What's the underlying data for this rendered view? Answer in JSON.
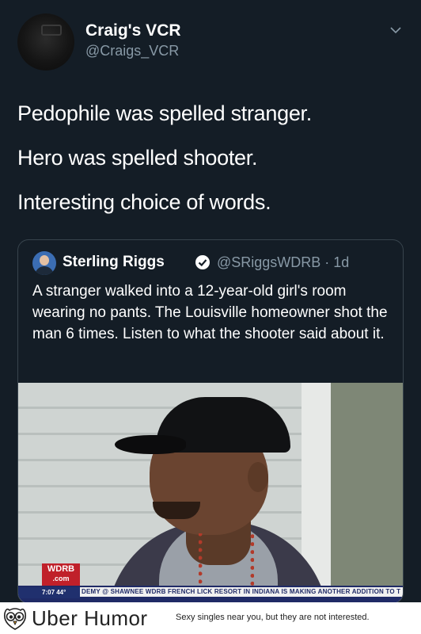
{
  "tweet": {
    "name": "Craig's VCR",
    "handle": "@Craigs_VCR",
    "lines": [
      "Pedophile was spelled stranger.",
      "Hero was spelled shooter.",
      "Interesting choice of words."
    ]
  },
  "quoted": {
    "name": "Sterling Riggs",
    "handle_time": "@SRiggsWDRB · 1d",
    "text": "A stranger walked into a 12-year-old girl's room wearing no pants. The Louisville homeowner shot the man 6 times. Listen to what the shooter said about it.",
    "video": {
      "logo_line1": "WDRB",
      "logo_line2": ".com",
      "time": "7:07  44°",
      "ticker": "DEMY @ SHAWNEE  WDRB  FRENCH LICK RESORT IN INDIANA IS MAKING ANOTHER ADDITION TO T"
    }
  },
  "footer": {
    "brand": "Uber Humor",
    "tagline": "Sexy singles near you, but they are not interested."
  },
  "colors": {
    "background": "#141d26",
    "secondary_text": "#8899a6",
    "border": "#38444d",
    "verified": "#ffffff"
  },
  "icons": [
    "chevron-down-icon",
    "verified-icon",
    "owl-logo-icon"
  ]
}
